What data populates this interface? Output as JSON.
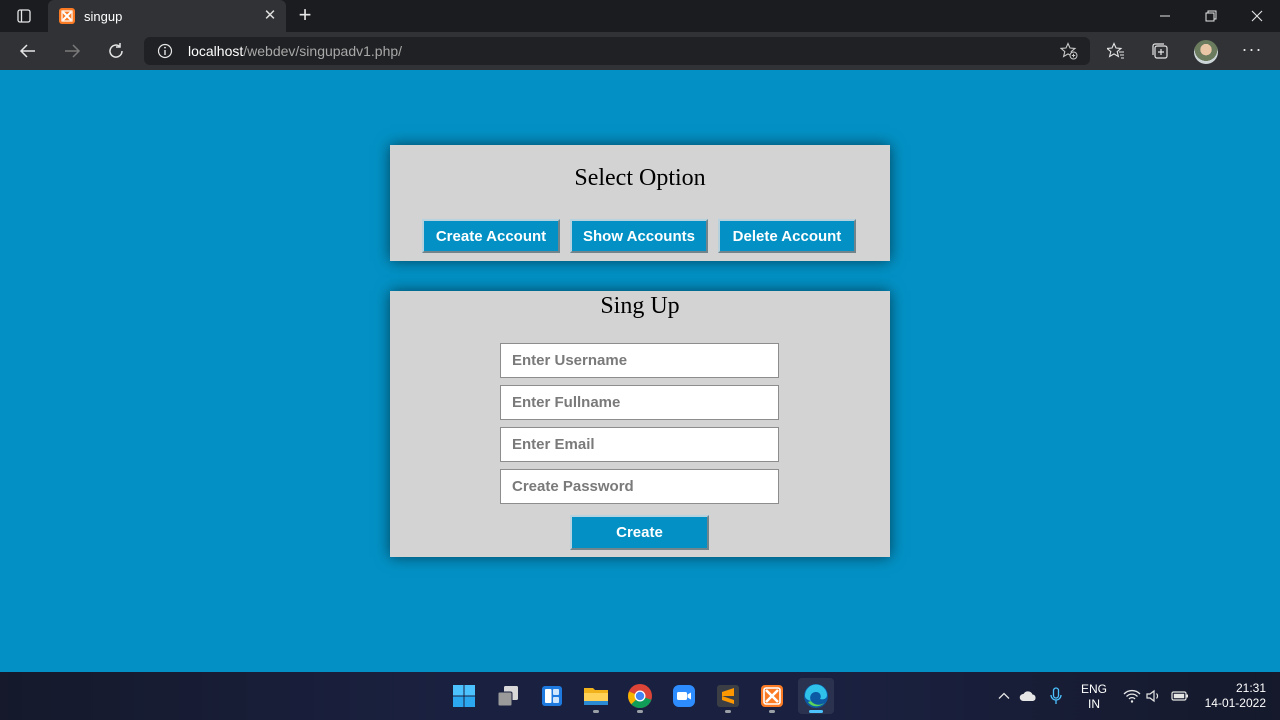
{
  "browser": {
    "tab_title": "singup",
    "tab_close": "✕",
    "new_tab": "+",
    "url_host": "localhost",
    "url_path": "/webdev/singupadv1.php/",
    "more_menu": "···"
  },
  "page": {
    "options_panel": {
      "title": "Select Option",
      "buttons": [
        "Create Account",
        "Show Accounts",
        "Delete Account"
      ]
    },
    "signup_panel": {
      "title": "Sing Up",
      "fields": {
        "username_placeholder": "Enter Username",
        "fullname_placeholder": "Enter Fullname",
        "email_placeholder": "Enter Email",
        "password_placeholder": "Create Password"
      },
      "submit_label": "Create"
    }
  },
  "taskbar": {
    "apps": [
      "start-icon",
      "task-view-icon",
      "widgets-icon",
      "file-explorer-icon",
      "chrome-icon",
      "zoom-icon",
      "sublime-text-icon",
      "xampp-icon",
      "edge-icon"
    ],
    "lang_line1": "ENG",
    "lang_line2": "IN",
    "time": "21:31",
    "date": "14-01-2022"
  },
  "colors": {
    "page_background": "#0391c5",
    "panel_background": "#d3d3d3",
    "button_background": "#0391c5"
  }
}
